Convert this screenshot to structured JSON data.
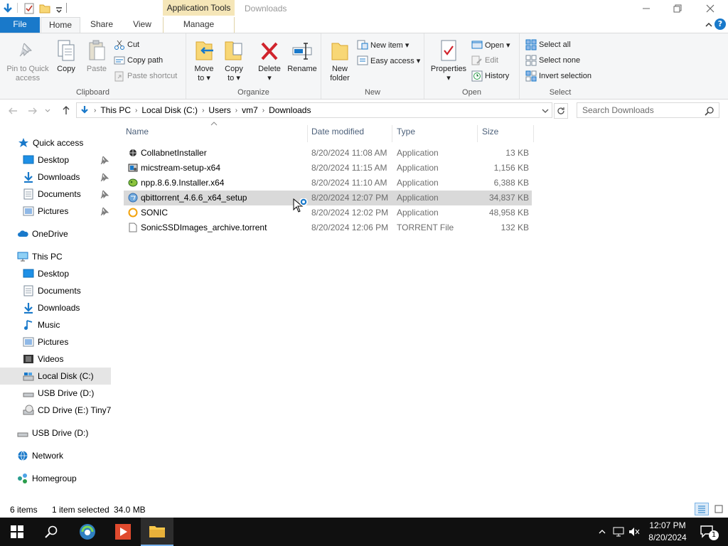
{
  "window": {
    "title": "Downloads",
    "context_tab": "Application Tools",
    "minimize_icon": "minimize-icon",
    "maximize_icon": "restore-icon",
    "close_icon": "close-icon"
  },
  "tabs": {
    "file": "File",
    "home": "Home",
    "share": "Share",
    "view": "View",
    "manage": "Manage"
  },
  "ribbon": {
    "clipboard": {
      "label": "Clipboard",
      "pin_line1": "Pin to Quick",
      "pin_line2": "access",
      "copy": "Copy",
      "paste": "Paste",
      "cut": "Cut",
      "copy_path": "Copy path",
      "paste_shortcut": "Paste shortcut"
    },
    "organize": {
      "label": "Organize",
      "move_line1": "Move",
      "move_line2": "to ▾",
      "copy_line1": "Copy",
      "copy_line2": "to ▾",
      "delete_line1": "Delete",
      "delete_line2": "▾",
      "rename": "Rename"
    },
    "new": {
      "label": "New",
      "folder_line1": "New",
      "folder_line2": "folder",
      "new_item": "New item ▾",
      "easy_access": "Easy access ▾"
    },
    "open": {
      "label": "Open",
      "properties_line1": "Properties",
      "properties_line2": "▾",
      "open": "Open ▾",
      "edit": "Edit",
      "history": "History"
    },
    "select": {
      "label": "Select",
      "select_all": "Select all",
      "select_none": "Select none",
      "invert": "Invert selection"
    }
  },
  "address": {
    "crumbs": [
      "This PC",
      "Local Disk (C:)",
      "Users",
      "vm7",
      "Downloads"
    ],
    "search_placeholder": "Search Downloads"
  },
  "nav": {
    "quick_access": "Quick access",
    "qa_desktop": "Desktop",
    "qa_downloads": "Downloads",
    "qa_documents": "Documents",
    "qa_pictures": "Pictures",
    "onedrive": "OneDrive",
    "this_pc": "This PC",
    "pc_desktop": "Desktop",
    "pc_documents": "Documents",
    "pc_downloads": "Downloads",
    "pc_music": "Music",
    "pc_pictures": "Pictures",
    "pc_videos": "Videos",
    "local_disk": "Local Disk (C:)",
    "usb_d": "USB Drive (D:)",
    "cd_drive": "CD Drive (E:) Tiny7 :",
    "usb_d2": "USB Drive (D:)",
    "network": "Network",
    "homegroup": "Homegroup"
  },
  "columns": {
    "name": "Name",
    "date": "Date modified",
    "type": "Type",
    "size": "Size"
  },
  "files": [
    {
      "name": "CollabnetInstaller",
      "date": "8/20/2024 11:08 AM",
      "type": "Application",
      "size": "13 KB",
      "icon": "installer-icon"
    },
    {
      "name": "micstream-setup-x64",
      "date": "8/20/2024 11:15 AM",
      "type": "Application",
      "size": "1,156 KB",
      "icon": "setup-icon"
    },
    {
      "name": "npp.8.6.9.Installer.x64",
      "date": "8/20/2024 11:10 AM",
      "type": "Application",
      "size": "6,388 KB",
      "icon": "notepadpp-icon"
    },
    {
      "name": "qbittorrent_4.6.6_x64_setup",
      "date": "8/20/2024 12:07 PM",
      "type": "Application",
      "size": "34,837 KB",
      "icon": "qbittorrent-icon"
    },
    {
      "name": "SONIC",
      "date": "8/20/2024 12:02 PM",
      "type": "Application",
      "size": "48,958 KB",
      "icon": "sonic-icon"
    },
    {
      "name": "SonicSSDImages_archive.torrent",
      "date": "8/20/2024 12:06 PM",
      "type": "TORRENT File",
      "size": "132 KB",
      "icon": "file-icon"
    }
  ],
  "status": {
    "count": "6 items",
    "selected": "1 item selected",
    "size": "34.0 MB"
  },
  "taskbar": {
    "time": "12:07 PM",
    "date": "8/20/2024",
    "notification_count": "1"
  },
  "colors": {
    "file_tab": "#1979ca",
    "context_tab": "#f5e6b8",
    "selection": "#d9d9d9",
    "taskbar": "#101010"
  }
}
